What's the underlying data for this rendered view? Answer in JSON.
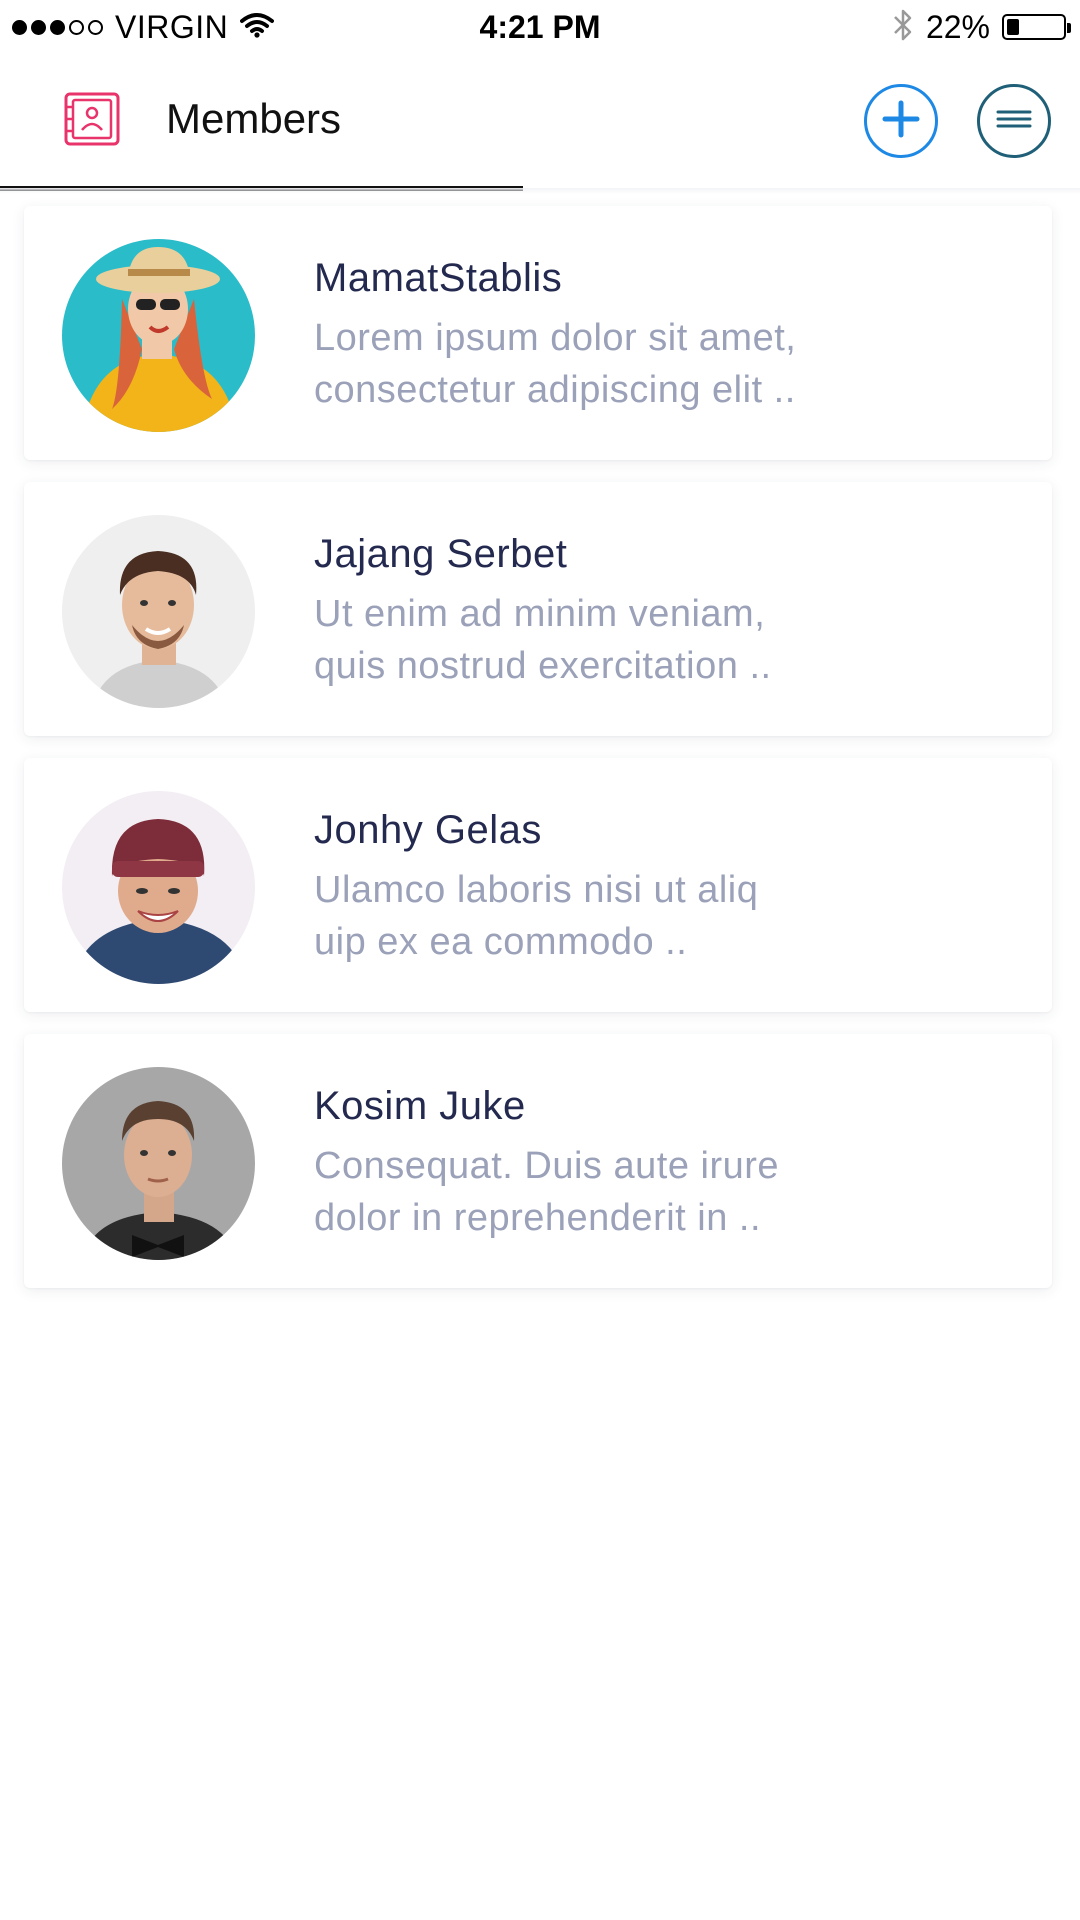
{
  "status_bar": {
    "carrier": "VIRGIN",
    "signal_filled": 3,
    "signal_total": 5,
    "time": "4:21 PM",
    "battery_text": "22%",
    "battery_level": 0.22
  },
  "header": {
    "title": "Members",
    "icon": "contacts-book-icon",
    "add_icon": "plus-icon",
    "menu_icon": "hamburger-menu-icon",
    "accent_color": "#e8336b",
    "add_color": "#1e88e5",
    "menu_color": "#1f5f77"
  },
  "members": [
    {
      "name": "MamatStablis",
      "desc_line1": "Lorem ipsum dolor sit amet,",
      "desc_line2": "consectetur adipiscing elit .."
    },
    {
      "name": "Jajang Serbet",
      "desc_line1": "Ut enim ad minim veniam,",
      "desc_line2": "quis nostrud exercitation .."
    },
    {
      "name": "Jonhy Gelas",
      "desc_line1": "Ulamco laboris nisi ut aliq",
      "desc_line2": "uip ex ea commodo  .."
    },
    {
      "name": "Kosim Juke",
      "desc_line1": "Consequat. Duis aute irure",
      "desc_line2": "dolor in reprehenderit in .."
    }
  ],
  "colors": {
    "name_text": "#23294f",
    "desc_text": "#9aa1b8"
  }
}
